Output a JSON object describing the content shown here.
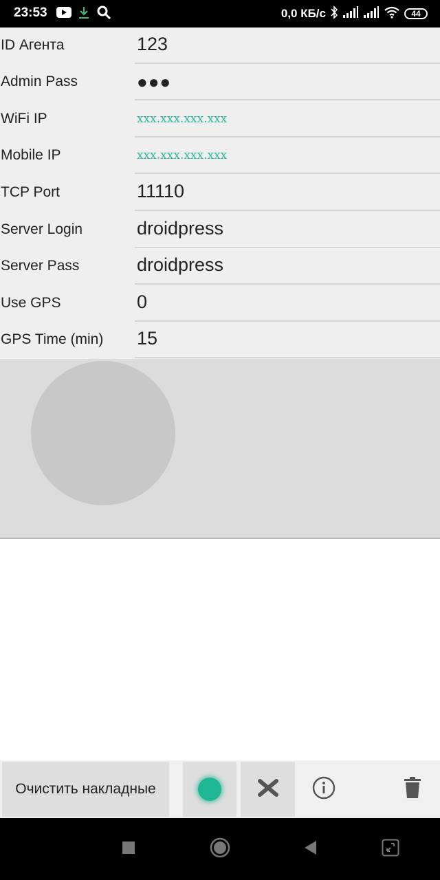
{
  "status_bar": {
    "time": "23:53",
    "speed": "0,0 КБ/с",
    "battery": "44",
    "icons": [
      "youtube-icon",
      "download-icon",
      "search-icon",
      "bluetooth-icon",
      "signal-icon",
      "signal-icon",
      "wifi-icon",
      "battery-icon"
    ]
  },
  "settings": {
    "rows": [
      {
        "label": "ID Агента",
        "value": "123"
      },
      {
        "label": "Admin Pass",
        "value": "●●●"
      },
      {
        "label": "WiFi IP",
        "value": "xxx.xxx.xxx.xxx"
      },
      {
        "label": "Mobile IP",
        "value": "xxx.xxx.xxx.xxx"
      },
      {
        "label": "TCP Port",
        "value": "11110"
      },
      {
        "label": "Server Login",
        "value": "droidpress"
      },
      {
        "label": "Server Pass",
        "value": "droidpress"
      },
      {
        "label": "Use GPS",
        "value": "0"
      },
      {
        "label": "GPS Time (min)",
        "value": "15"
      }
    ]
  },
  "toolbar": {
    "clear_label": "Очистить накладные",
    "icons": [
      "status-dot-icon",
      "close-icon",
      "info-icon",
      "trash-icon"
    ]
  },
  "colors": {
    "accent": "#20b894",
    "ip_text": "#2bb89a",
    "background": "#efefef"
  },
  "nav_bar": {
    "icons": [
      "recents-icon",
      "home-icon",
      "back-icon",
      "screenshot-icon"
    ]
  }
}
